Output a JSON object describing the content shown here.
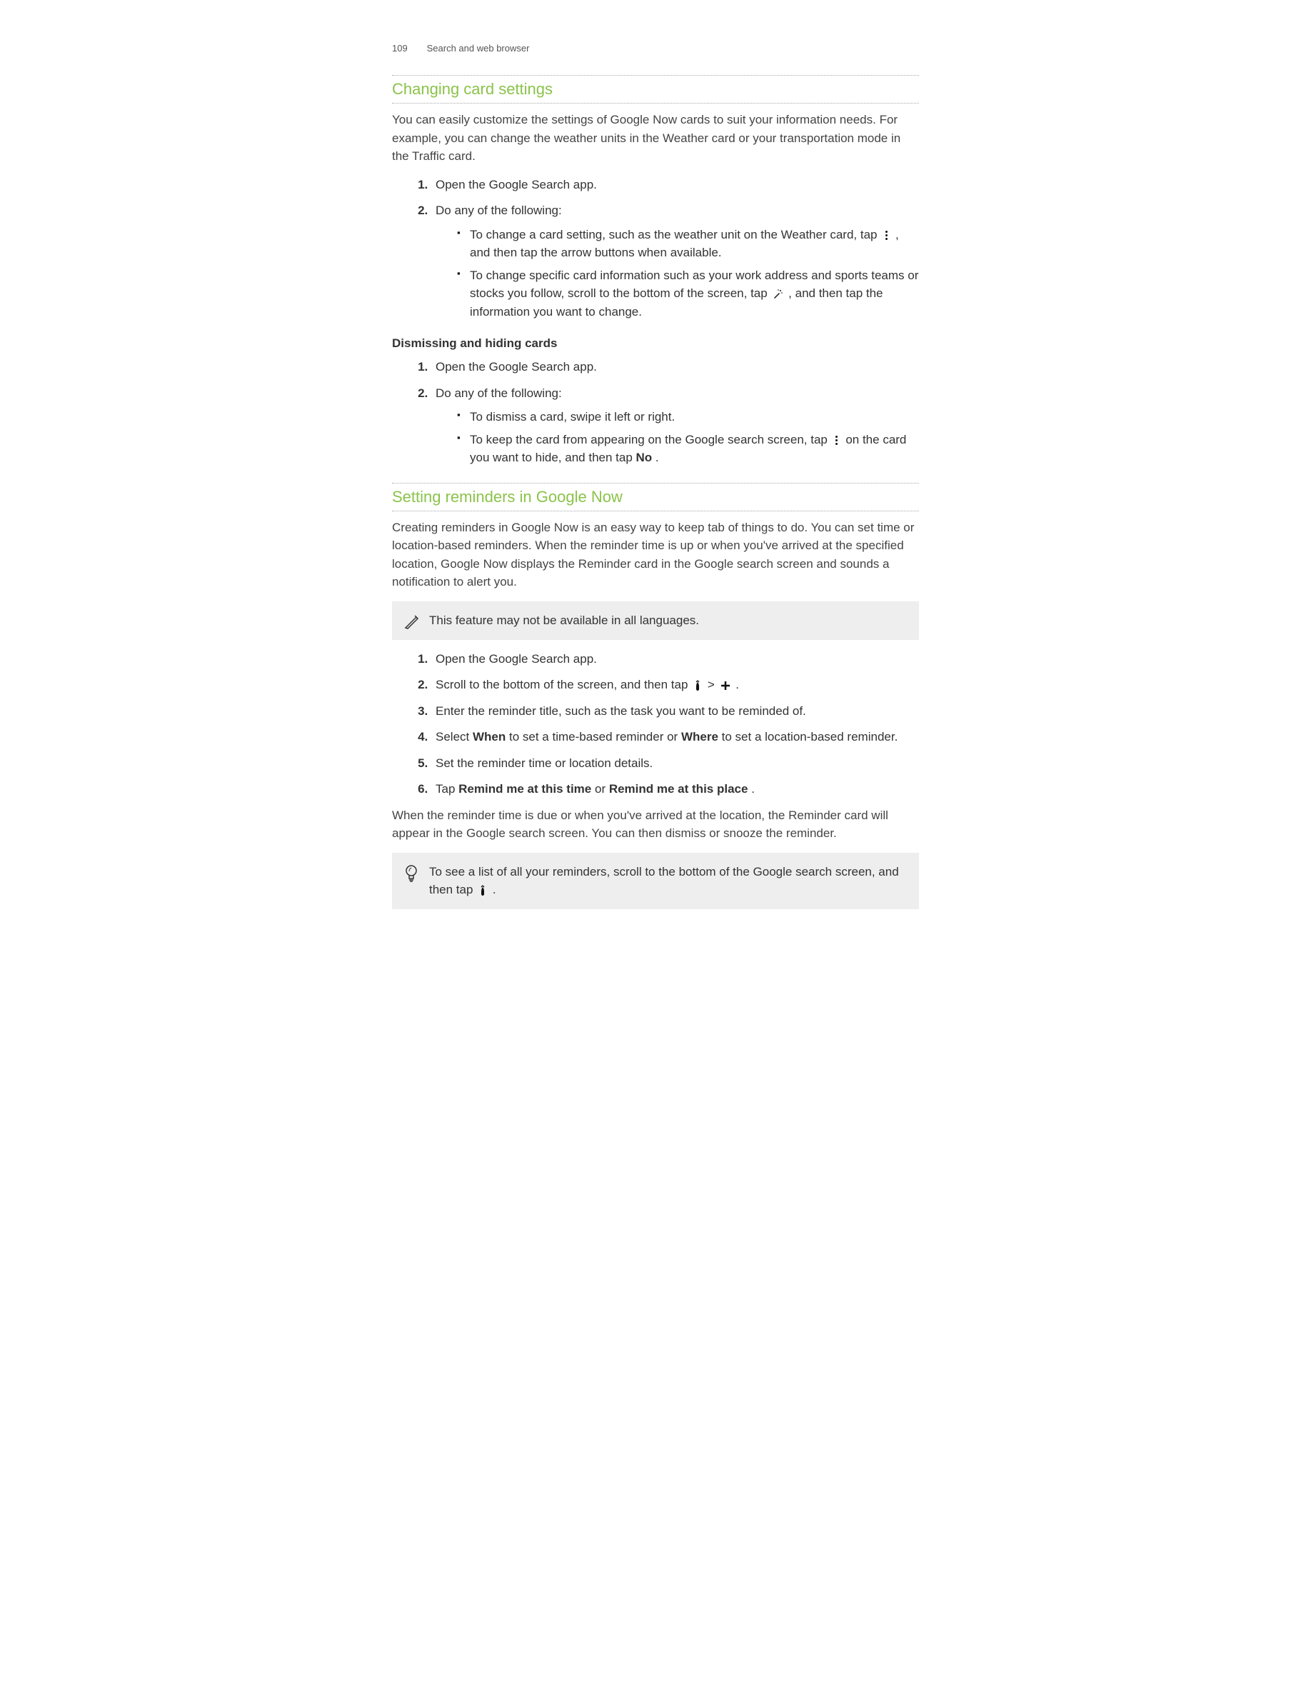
{
  "header": {
    "page_number": "109",
    "breadcrumb": "Search and web browser"
  },
  "section1": {
    "heading": "Changing card settings",
    "intro": "You can easily customize the settings of Google Now cards to suit your information needs. For example, you can change the weather units in the Weather card or your transportation mode in the Traffic card.",
    "steps": {
      "s1": "Open the Google Search app.",
      "s2": "Do any of the following:",
      "s2_bullets": {
        "b1a": "To change a card setting, such as the weather unit on the Weather card, tap ",
        "b1b": " , and then tap the arrow buttons when available.",
        "b2a": "To change specific card information such as your work address and sports teams or stocks you follow, scroll to the bottom of the screen, tap ",
        "b2b": " , and then tap the information you want to change."
      }
    },
    "subheading": "Dismissing and hiding cards",
    "steps2": {
      "s1": "Open the Google Search app.",
      "s2": "Do any of the following:",
      "s2_bullets": {
        "b1": "To dismiss a card, swipe it left or right.",
        "b2a": "To keep the card from appearing on the Google search screen, tap ",
        "b2b": " on the card you want to hide, and then tap ",
        "b2c": "No",
        "b2d": "."
      }
    }
  },
  "section2": {
    "heading": "Setting reminders in Google Now",
    "intro": "Creating reminders in Google Now is an easy way to keep tab of things to do. You can set time or location-based reminders. When the reminder time is up or when you've arrived at the specified location, Google Now displays the Reminder card in the Google search screen and sounds a notification to alert you.",
    "note": "This feature may not be available in all languages.",
    "steps": {
      "s1": "Open the Google Search app.",
      "s2a": "Scroll to the bottom of the screen, and then tap ",
      "s2b": "  >  ",
      "s2c": ".",
      "s3": "Enter the reminder title, such as the task you want to be reminded of.",
      "s4a": "Select ",
      "s4b": "When",
      "s4c": " to set a time-based reminder or ",
      "s4d": "Where",
      "s4e": " to set a location-based reminder.",
      "s5": "Set the reminder time or location details.",
      "s6a": "Tap ",
      "s6b": "Remind me at this time",
      "s6c": " or ",
      "s6d": "Remind me at this place",
      "s6e": "."
    },
    "outro": "When the reminder time is due or when you've arrived at the location, the Reminder card will appear in the Google search screen. You can then dismiss or snooze the reminder.",
    "tip_a": "To see a list of all your reminders, scroll to the bottom of the Google search screen, and then tap ",
    "tip_b": " ."
  }
}
